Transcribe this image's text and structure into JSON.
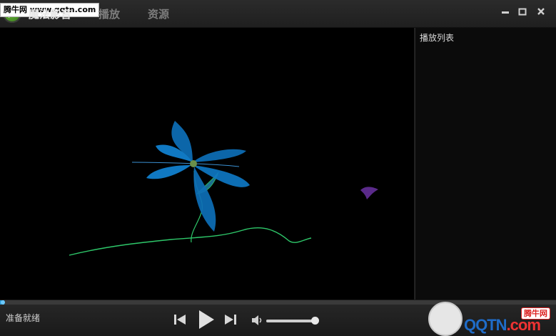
{
  "app": {
    "watermark": "腾牛网 www.qqtn.com",
    "tabs": [
      {
        "label": "魔法影音"
      },
      {
        "label": "播放"
      },
      {
        "label": "资源"
      }
    ]
  },
  "playlist": {
    "title": "播放列表"
  },
  "status": {
    "text": "准备就绪"
  },
  "progress": {
    "fraction": 0.008
  },
  "volume": {
    "fraction": 0.95
  },
  "branding": {
    "site": "QQTN",
    "site_suffix": ".com",
    "badge": "腾牛网"
  },
  "colors": {
    "accent": "#2a9ad6",
    "background": "#000000"
  },
  "icons": [
    "logo-icon",
    "minimize-icon",
    "maximize-icon",
    "close-icon",
    "previous-icon",
    "play-icon",
    "next-icon",
    "volume-icon"
  ]
}
